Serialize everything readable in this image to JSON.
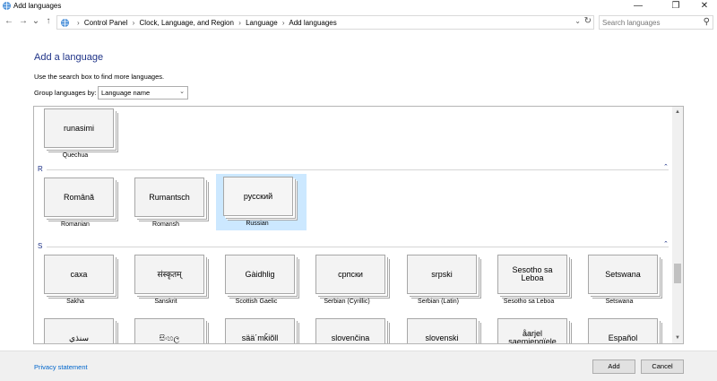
{
  "window": {
    "title": "Add languages",
    "minimize": "—",
    "restore": "❐",
    "close": "✕"
  },
  "nav": {
    "back": "←",
    "forward": "→",
    "recent": "⌄",
    "up": "↑"
  },
  "address": {
    "crumbs": [
      "Control Panel",
      "Clock, Language, and Region",
      "Language",
      "Add languages"
    ],
    "separator": "›",
    "dropdown": "⌄",
    "refresh": "↻"
  },
  "search": {
    "placeholder": "Search languages",
    "icon": "⚲"
  },
  "page": {
    "heading": "Add a language",
    "hint": "Use the search box to find more languages.",
    "group_label": "Group languages by:",
    "group_value": "Language name",
    "group_arrow": "⌄"
  },
  "sections": [
    {
      "letter": "R",
      "collapse": "⌃"
    },
    {
      "letter": "S",
      "collapse": "⌃"
    }
  ],
  "tiles": {
    "q": [
      {
        "native": "runasimi",
        "name": "Quechua"
      }
    ],
    "r": [
      {
        "native": "Română",
        "name": "Romanian"
      },
      {
        "native": "Rumantsch",
        "name": "Romansh"
      },
      {
        "native": "русский",
        "name": "Russian",
        "selected": true
      }
    ],
    "s": [
      {
        "native": "саха",
        "name": "Sakha"
      },
      {
        "native": "संस्कृतम्",
        "name": "Sanskrit"
      },
      {
        "native": "Gàidhlig",
        "name": "Scottish Gaelic"
      },
      {
        "native": "српски",
        "name": "Serbian (Cyrillic)"
      },
      {
        "native": "srpski",
        "name": "Serbian (Latin)"
      },
      {
        "native": "Sesotho sa Leboa",
        "name": "Sesotho sa Leboa"
      },
      {
        "native": "Setswana",
        "name": "Setswana"
      }
    ],
    "s2": [
      {
        "native": "سنڌي"
      },
      {
        "native": "සිංහල"
      },
      {
        "native": "sää´mǩiõll"
      },
      {
        "native": "slovenčina"
      },
      {
        "native": "slovenski"
      },
      {
        "native": "åarjel saemiengïele"
      },
      {
        "native": "Español"
      }
    ]
  },
  "scroll": {
    "up": "▲",
    "down": "▼"
  },
  "footer": {
    "privacy": "Privacy statement",
    "add": "Add",
    "cancel": "Cancel"
  }
}
